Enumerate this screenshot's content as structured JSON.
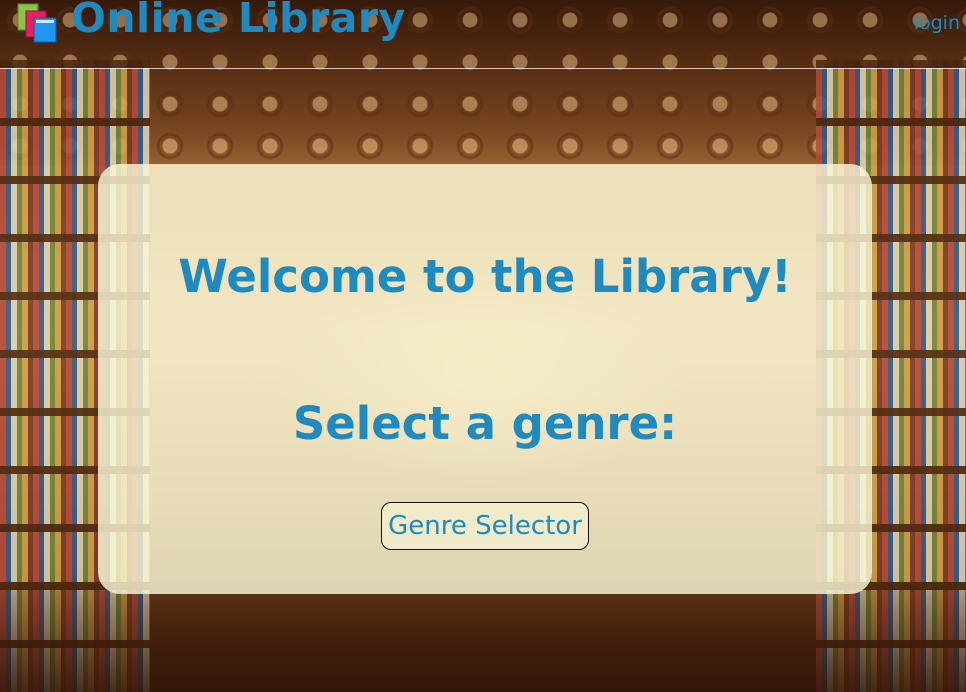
{
  "header": {
    "title": "Online Library",
    "login_label": "login"
  },
  "main": {
    "welcome_heading": "Welcome to the Library!",
    "select_heading": "Select a genre:",
    "genre_button_label": "Genre Selector"
  },
  "colors": {
    "accent": "#1f8ac0",
    "card_background": "#faf6d6"
  },
  "icons": {
    "logo": "books-icon"
  }
}
